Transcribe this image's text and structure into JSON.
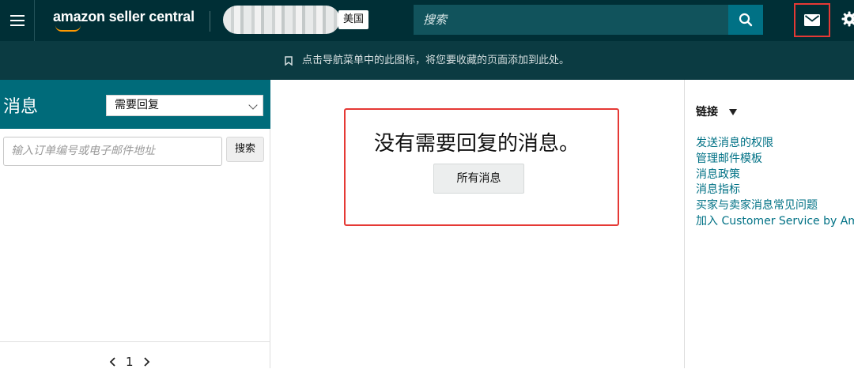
{
  "header": {
    "logo_text": "amazon seller central",
    "country": "美国",
    "search_placeholder": "搜索"
  },
  "notice": {
    "text": "点击导航菜单中的此图标，将您要收藏的页面添加到此处。"
  },
  "left_panel": {
    "title": "消息",
    "filter_selected": "需要回复",
    "search_placeholder": "输入订单编号或电子邮件地址",
    "search_button": "搜索",
    "page_number": "1"
  },
  "main": {
    "empty_message": "没有需要回复的消息。",
    "all_messages_button": "所有消息"
  },
  "right_panel": {
    "heading": "链接",
    "links": [
      "发送消息的权限",
      "管理邮件模板",
      "消息政策",
      "消息指标",
      "买家与卖家消息常见问题",
      "加入 Customer Service by Amazon"
    ]
  },
  "colors": {
    "topbar": "#002f36",
    "notice_bar": "#0b3b42",
    "panel_header": "#006b7a",
    "link": "#007185",
    "highlight_border": "#e53935"
  },
  "icons": [
    "menu-icon",
    "search-icon",
    "mail-icon",
    "gear-icon",
    "bookmark-icon",
    "chevron-down-icon",
    "chevron-left-icon",
    "chevron-right-icon",
    "caret-down-icon"
  ]
}
